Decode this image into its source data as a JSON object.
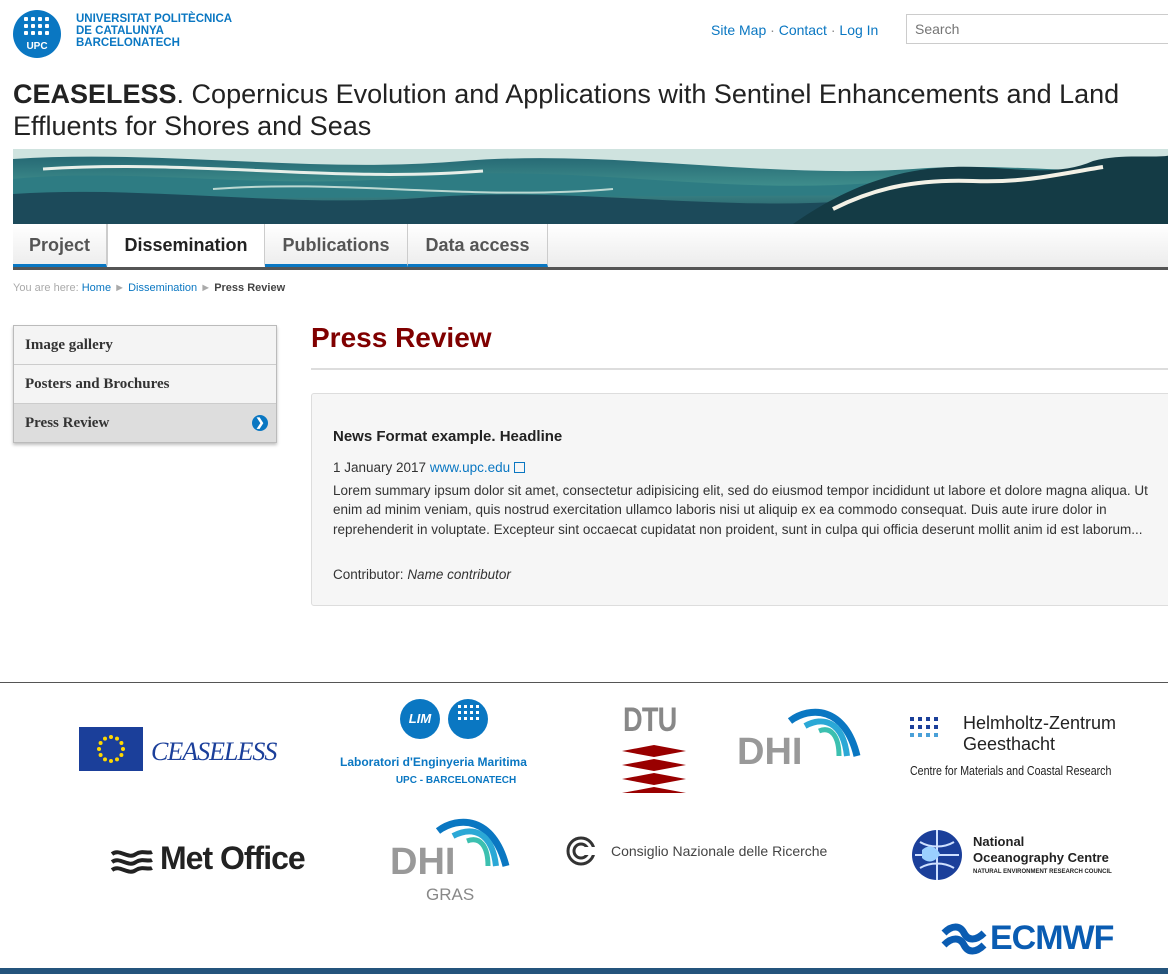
{
  "header": {
    "university_line1": "UNIVERSITAT POLITÈCNICA",
    "university_line2": "DE CATALUNYA",
    "university_line3": "BARCELONATECH",
    "logo_text": "UPC",
    "links": [
      "Site Map",
      "Contact",
      "Log In"
    ],
    "search_placeholder": "Search"
  },
  "title": {
    "acronym": "CEASELESS",
    "rest": ". Copernicus Evolution and Applications with Sentinel Enhancements and Land Effluents for Shores and Seas"
  },
  "nav": {
    "tabs": [
      "Project",
      "Dissemination",
      "Publications",
      "Data access"
    ],
    "active": "Dissemination"
  },
  "breadcrumb": {
    "prefix": "You are here:",
    "home": "Home",
    "section": "Dissemination",
    "current": "Press Review",
    "sep": "►"
  },
  "sidebar": {
    "items": [
      "Image gallery",
      "Posters and Brochures",
      "Press Review"
    ],
    "active": "Press Review"
  },
  "main": {
    "heading": "Press Review",
    "news": {
      "headline": "News Format example. Headline",
      "date": "1 January 2017",
      "link": "www.upc.edu",
      "summary": "Lorem summary ipsum dolor sit amet, consectetur adipisicing elit, sed do eiusmod tempor incididunt ut labore et dolore magna aliqua. Ut enim ad minim veniam, quis nostrud exercitation ullamco laboris nisi ut aliquip ex ea commodo consequat. Duis aute irure dolor in reprehenderit in voluptate. Excepteur sint occaecat cupidatat non proident, sunt in culpa qui officia deserunt mollit anim id est laborum...",
      "contributor_label": "Contributor:",
      "contributor_name": "Name contributor"
    }
  },
  "footer": {
    "ceaseless": "CEASELESS",
    "lim_badge": "LIM",
    "lim_name": "Laboratori d'Enginyeria Maritima",
    "lim_sub": "UPC - BARCELONATECH",
    "dtu": "DTU",
    "dhi": "DHI",
    "hzg_line1": "Helmholtz-Zentrum",
    "hzg_line2": "Geesthacht",
    "hzg_sub": "Centre for Materials and Coastal Research",
    "metoffice": "Met Office",
    "dhi_gras": "DHI",
    "dhi_gras_sub": "GRAS",
    "cnr": "Consiglio Nazionale delle Ricerche",
    "noc_line1": "National",
    "noc_line2": "Oceanography Centre",
    "noc_sub": "NATURAL ENVIRONMENT RESEARCH COUNCIL",
    "ecmwf": "ECMWF"
  },
  "colors": {
    "brand_blue": "#0a77c2",
    "heading_red": "#800000",
    "footer_bar": "#24547c"
  }
}
